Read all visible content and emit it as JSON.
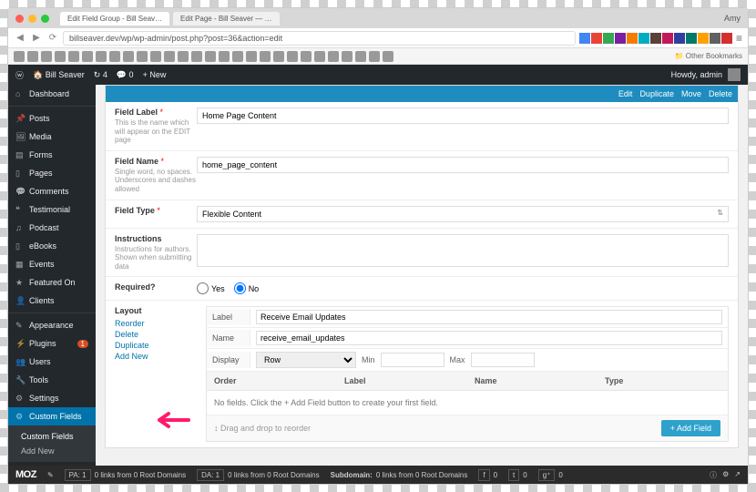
{
  "browser": {
    "user": "Amy",
    "tabs": [
      "Edit Field Group - Bill Seav…",
      "Edit Page - Bill Seaver — …"
    ],
    "url": "billseaver.dev/wp/wp-admin/post.php?post=36&action=edit",
    "other_bookmarks": "Other Bookmarks"
  },
  "wpbar": {
    "site": "Bill Seaver",
    "comments": "4",
    "updates": "0",
    "new": "+ New",
    "howdy": "Howdy, admin"
  },
  "sidebar": {
    "items": [
      {
        "label": "Dashboard"
      },
      {
        "label": "Posts"
      },
      {
        "label": "Media"
      },
      {
        "label": "Forms"
      },
      {
        "label": "Pages"
      },
      {
        "label": "Comments"
      },
      {
        "label": "Testimonial"
      },
      {
        "label": "Podcast"
      },
      {
        "label": "eBooks"
      },
      {
        "label": "Events"
      },
      {
        "label": "Featured On"
      },
      {
        "label": "Clients"
      },
      {
        "label": "Appearance"
      },
      {
        "label": "Plugins",
        "badge": "1"
      },
      {
        "label": "Users"
      },
      {
        "label": "Tools"
      },
      {
        "label": "Settings"
      },
      {
        "label": "Custom Fields"
      }
    ],
    "sub": [
      "Custom Fields",
      "Add New"
    ]
  },
  "fg": {
    "actions": {
      "edit": "Edit",
      "dup": "Duplicate",
      "move": "Move",
      "del": "Delete"
    },
    "field_label": {
      "title": "Field Label",
      "hint": "This is the name which will appear on the EDIT page",
      "value": "Home Page Content"
    },
    "field_name": {
      "title": "Field Name",
      "hint": "Single word, no spaces. Underscores and dashes allowed",
      "value": "home_page_content"
    },
    "field_type": {
      "title": "Field Type",
      "value": "Flexible Content"
    },
    "instructions": {
      "title": "Instructions",
      "hint": "Instructions for authors. Shown when submitting data",
      "value": ""
    },
    "required": {
      "title": "Required?",
      "yes": "Yes",
      "no": "No"
    },
    "layout": {
      "title": "Layout",
      "links": {
        "reorder": "Reorder",
        "delete": "Delete",
        "duplicate": "Duplicate",
        "add": "Add New"
      },
      "label_t": "Label",
      "label_v": "Receive Email Updates",
      "name_t": "Name",
      "name_v": "receive_email_updates",
      "display_t": "Display",
      "display_v": "Row",
      "min_t": "Min",
      "max_t": "Max",
      "head": {
        "order": "Order",
        "label": "Label",
        "name": "Name",
        "type": "Type"
      },
      "empty": "No fields. Click the + Add Field button to create your first field.",
      "drag": "Drag and drop to reorder",
      "add_field": "+ Add Field"
    }
  },
  "moz": {
    "logo": "MOZ",
    "pa": "PA: 1",
    "links1": "0 links from 0 Root Domains",
    "da": "DA: 1",
    "links2": "0 links from 0 Root Domains",
    "sub": "Subdomain:",
    "links3": "0 links from 0 Root Domains",
    "f": "f",
    "t": "t",
    "g": "g⁺",
    "zero": "0"
  }
}
